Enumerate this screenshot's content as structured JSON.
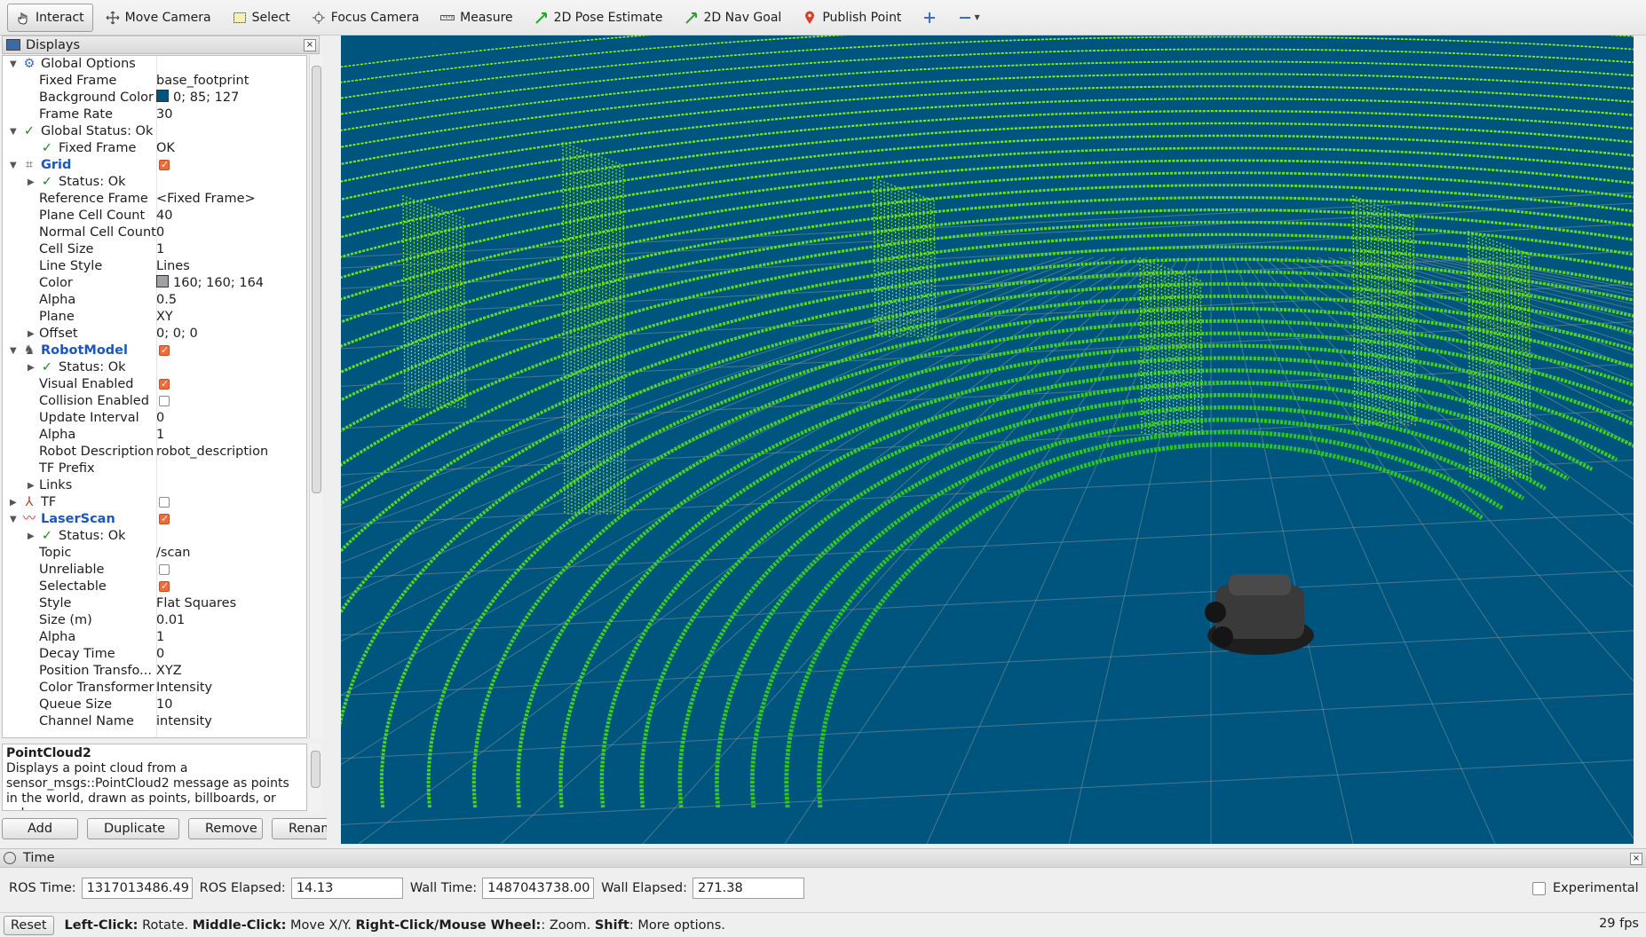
{
  "toolbar": {
    "interact": "Interact",
    "move_camera": "Move Camera",
    "select": "Select",
    "focus_camera": "Focus Camera",
    "measure": "Measure",
    "pose_estimate": "2D Pose Estimate",
    "nav_goal": "2D Nav Goal",
    "publish_point": "Publish Point"
  },
  "displays": {
    "title": "Displays",
    "rows": {
      "global_options": "Global Options",
      "fixed_frame": "Fixed Frame",
      "fixed_frame_val": "base_footprint",
      "bg_color": "Background Color",
      "bg_color_val": "0; 85; 127",
      "frame_rate": "Frame Rate",
      "frame_rate_val": "30",
      "global_status": "Global Status: Ok",
      "gs_fixed_frame": "Fixed Frame",
      "gs_fixed_frame_val": "OK",
      "grid": "Grid",
      "grid_status": "Status: Ok",
      "ref_frame": "Reference Frame",
      "ref_frame_val": "<Fixed Frame>",
      "plane_cell_count": "Plane Cell Count",
      "plane_cell_count_val": "40",
      "normal_cell_count": "Normal Cell Count",
      "normal_cell_count_val": "0",
      "cell_size": "Cell Size",
      "cell_size_val": "1",
      "line_style": "Line Style",
      "line_style_val": "Lines",
      "color": "Color",
      "color_val": "160; 160; 164",
      "alpha": "Alpha",
      "alpha_val": "0.5",
      "plane": "Plane",
      "plane_val": "XY",
      "offset": "Offset",
      "offset_val": "0; 0; 0",
      "robot_model": "RobotModel",
      "rm_status": "Status: Ok",
      "visual_enabled": "Visual Enabled",
      "collision_enabled": "Collision Enabled",
      "update_interval": "Update Interval",
      "update_interval_val": "0",
      "rm_alpha": "Alpha",
      "rm_alpha_val": "1",
      "robot_description": "Robot Description",
      "robot_description_val": "robot_description",
      "tf_prefix": "TF Prefix",
      "links": "Links",
      "tf": "TF",
      "laserscan": "LaserScan",
      "ls_status": "Status: Ok",
      "topic": "Topic",
      "topic_val": "/scan",
      "unreliable": "Unreliable",
      "selectable": "Selectable",
      "style": "Style",
      "style_val": "Flat Squares",
      "size": "Size (m)",
      "size_val": "0.01",
      "ls_alpha": "Alpha",
      "ls_alpha_val": "1",
      "decay_time": "Decay Time",
      "decay_time_val": "0",
      "position_transformer": "Position Transfo...",
      "position_transformer_val": "XYZ",
      "color_transformer": "Color Transformer",
      "color_transformer_val": "Intensity",
      "queue_size": "Queue Size",
      "queue_size_val": "10",
      "channel_name": "Channel Name",
      "channel_name_val": "intensity"
    }
  },
  "description": {
    "title": "PointCloud2",
    "text": "Displays a point cloud from a sensor_msgs::PointCloud2 message as points in the world, drawn as points, billboards, or cubes."
  },
  "buttons": {
    "add": "Add",
    "duplicate": "Duplicate",
    "remove": "Remove",
    "rename": "Rename"
  },
  "time": {
    "title": "Time",
    "ros_time_label": "ROS Time:",
    "ros_time": "1317013486.49",
    "ros_elapsed_label": "ROS Elapsed:",
    "ros_elapsed": "14.13",
    "wall_time_label": "Wall Time:",
    "wall_time": "1487043738.00",
    "wall_elapsed_label": "Wall Elapsed:",
    "wall_elapsed": "271.38",
    "experimental": "Experimental"
  },
  "status": {
    "reset": "Reset",
    "left_click": "Left-Click:",
    "left_click_desc": " Rotate. ",
    "middle_click": "Middle-Click:",
    "middle_click_desc": " Move X/Y. ",
    "right_click": "Right-Click/Mouse Wheel:",
    "right_click_desc": ": Zoom. ",
    "shift": "Shift",
    "shift_desc": ": More options.",
    "fps": "29 fps"
  },
  "colors": {
    "background": "#00557f",
    "grid_color": "#a0a0a4",
    "points_near": "#33cc22",
    "points_far": "#88ee22",
    "accent_checkbox": "#ef6b3a"
  }
}
